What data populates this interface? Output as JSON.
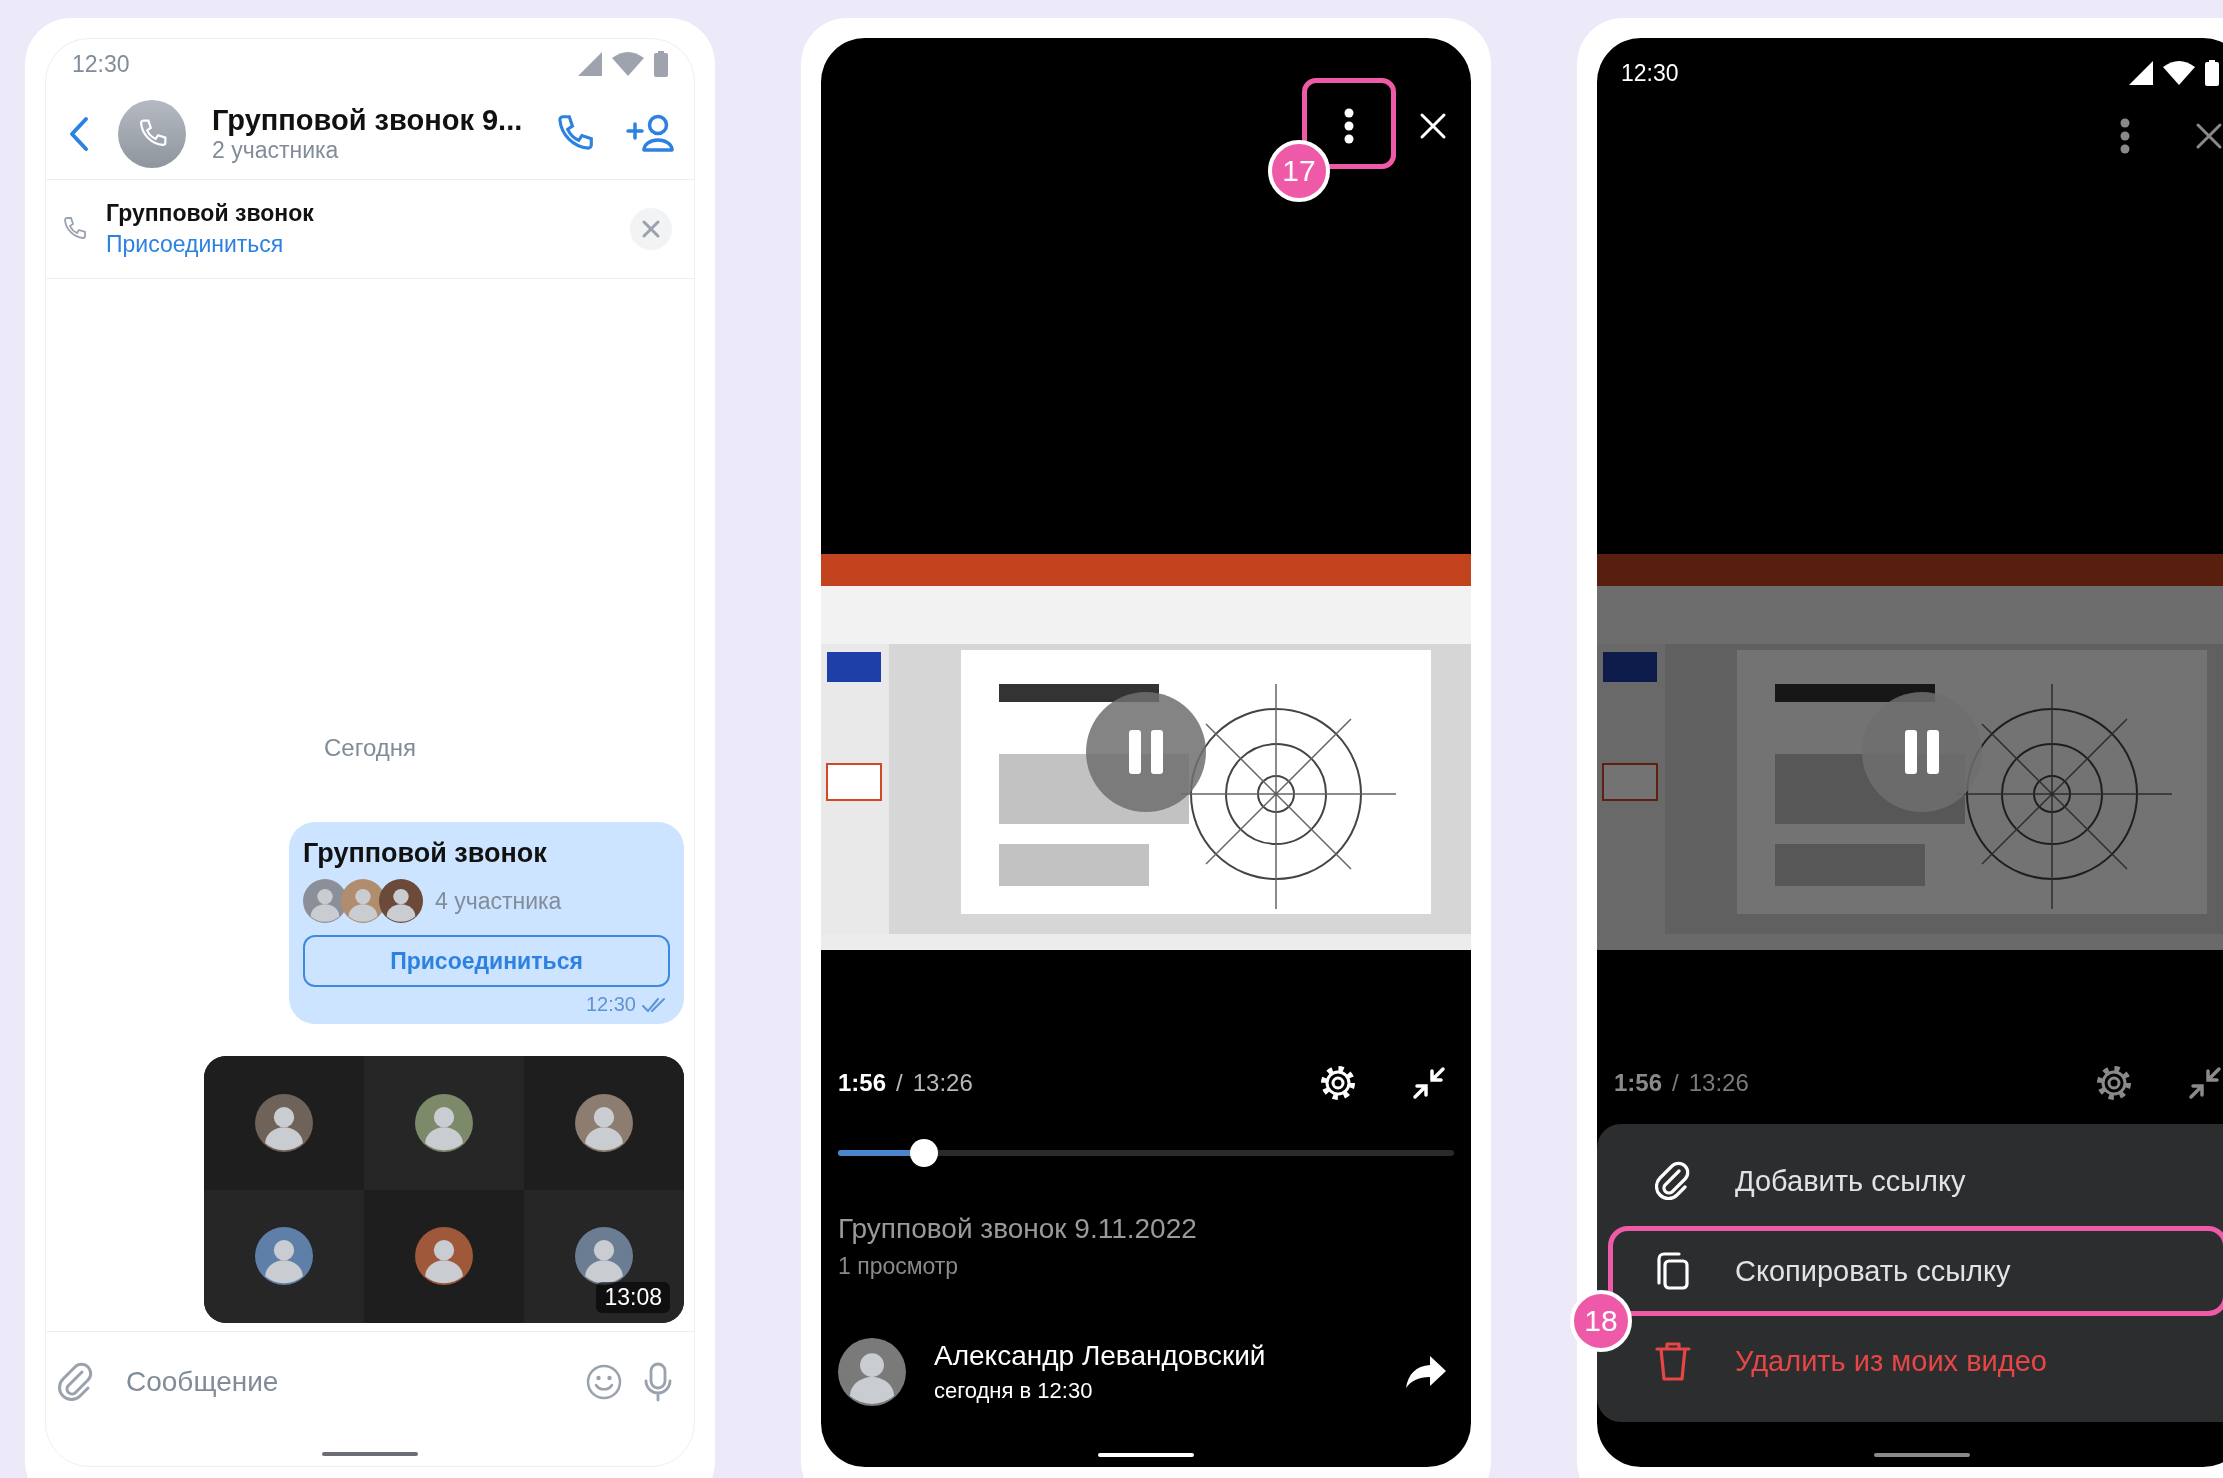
{
  "chat_screen": {
    "status_time": "12:30",
    "header": {
      "title": "Групповой звонок 9...",
      "subtitle": "2 участника"
    },
    "call_banner": {
      "title": "Групповой звонок",
      "action": "Присоединиться"
    },
    "date_label": "Сегодня",
    "call_message": {
      "title": "Групповой звонок",
      "participants": "4 участника",
      "join_button": "Присоединиться",
      "time": "12:30",
      "read": true
    },
    "video_message": {
      "duration": "13:08"
    },
    "composer": {
      "placeholder": "Сообщение"
    }
  },
  "player_screen": {
    "more_button": {
      "highlighted": true,
      "step": "17"
    },
    "time": {
      "current": "1:56",
      "separator": "/",
      "total": "13:26"
    },
    "progress": {
      "level": 0.14
    },
    "video_title": "Групповой звонок 9.11.2022",
    "views": "1 просмотр",
    "author": {
      "name": "Александр Левандовский",
      "time": "сегодня в 12:30"
    }
  },
  "menu_screen": {
    "status_time": "12:30",
    "time": {
      "current": "1:56",
      "separator": "/",
      "total": "13:26"
    },
    "menu": [
      {
        "label": "Добавить ссылку",
        "kind": "link",
        "highlighted": false
      },
      {
        "label": "Скопировать ссылку",
        "kind": "copy",
        "highlighted": true,
        "step": "18"
      },
      {
        "label": "Удалить из моих видео",
        "kind": "delete",
        "highlighted": false
      }
    ]
  }
}
